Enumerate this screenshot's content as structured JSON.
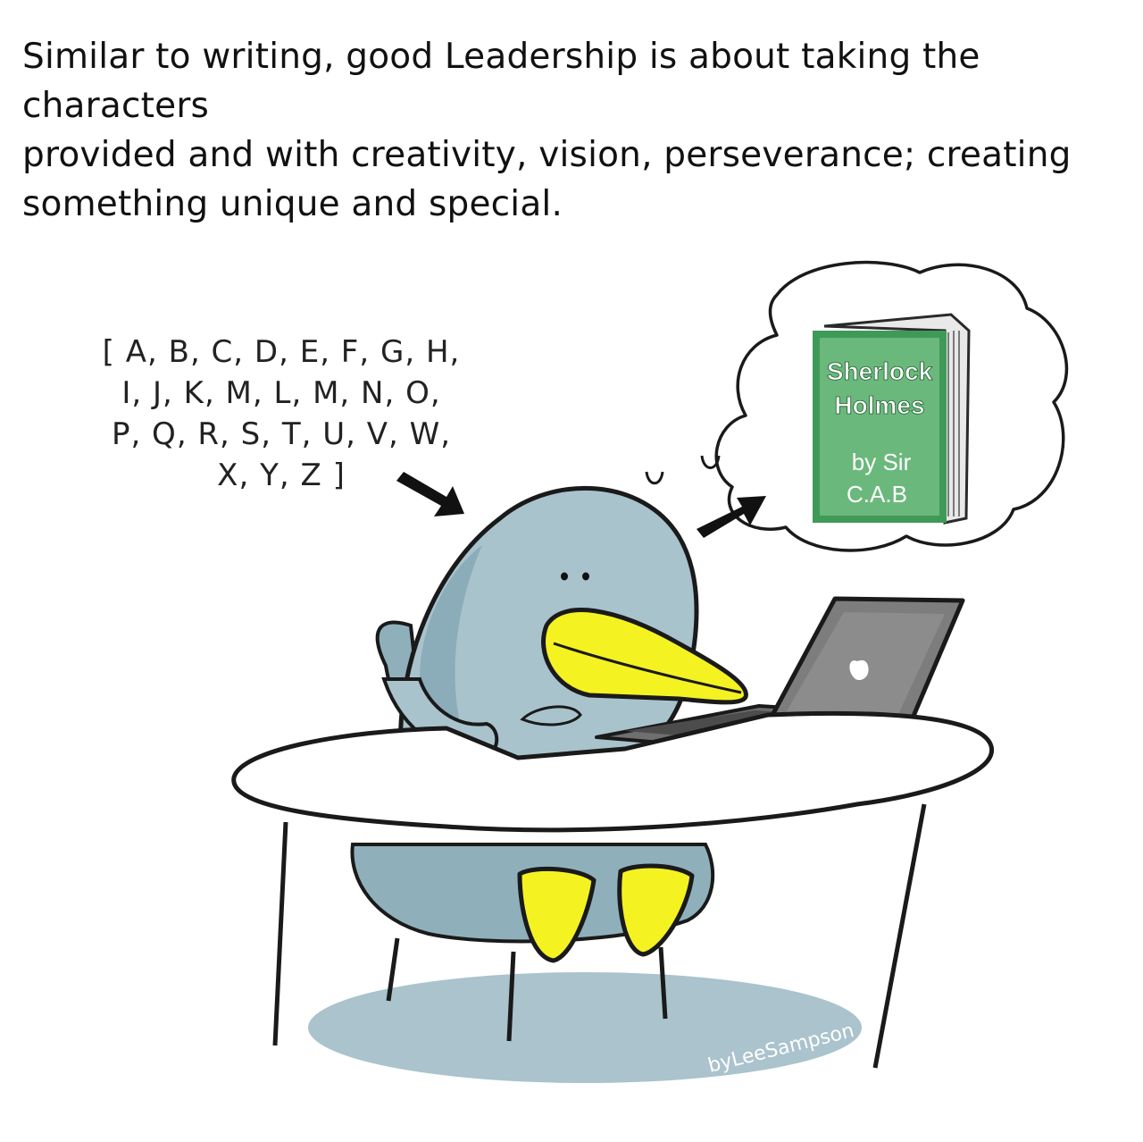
{
  "caption": {
    "line1": "Similar to writing, good Leadership is about taking the characters",
    "line2": "provided and with creativity, vision, perseverance; creating",
    "line3": "something unique and special."
  },
  "alphabet": {
    "line1": "[ A, B, C, D, E, F, G, H,",
    "line2": "I, J, K, M, L, M, N, O,",
    "line3": "P, Q, R, S, T, U, V, W,",
    "line4": "X, Y, Z ]"
  },
  "book": {
    "title_line1": "Sherlock",
    "title_line2": "Holmes",
    "author_line1": "by Sir",
    "author_line2": "C.A.B"
  },
  "signature": "byLeeSampson",
  "colors": {
    "penguin_body": "#a9c3cd",
    "beak_and_feet": "#f5f222",
    "book_cover": "#3f9a58",
    "laptop": "#7d7d7d",
    "outline": "#1a1a1a"
  }
}
